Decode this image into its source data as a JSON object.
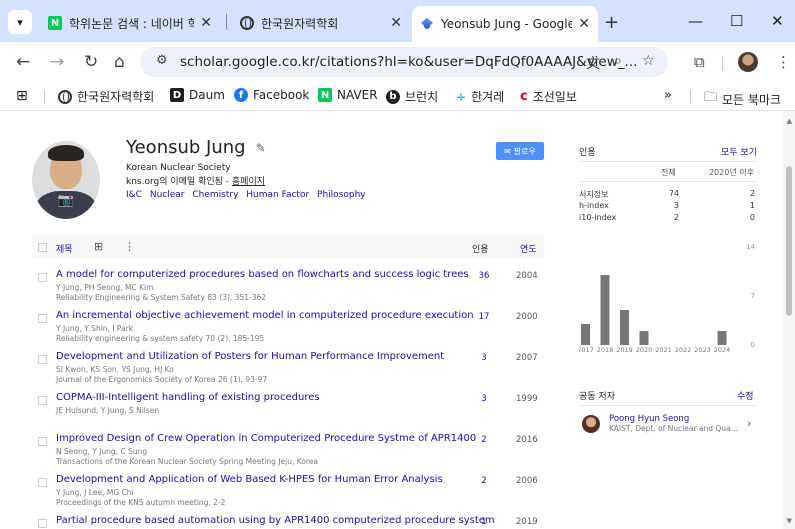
{
  "tabs": [
    {
      "title": "학위논문 검색 : 네이버 학",
      "active": false
    },
    {
      "title": "한국원자력학회",
      "active": false
    },
    {
      "title": "Yeonsub Jung - Google",
      "active": true
    }
  ],
  "toolbar": {
    "url": "scholar.google.co.kr/citations?hl=ko&user=DqFdQf0AAAAJ&view_..."
  },
  "bookmarks": [
    {
      "label": "한국원자력학회",
      "icon": "globe-icon"
    },
    {
      "label": "Daum",
      "icon": "daum-icon",
      "glyph": "D",
      "color": "#1f1f1f"
    },
    {
      "label": "Facebook",
      "icon": "facebook-icon",
      "glyph": "f",
      "color": "#1877f2"
    },
    {
      "label": "NAVER",
      "icon": "naver-icon",
      "glyph": "N",
      "color": "#03c75a"
    },
    {
      "label": "브런치",
      "icon": "brunch-icon",
      "glyph": "b",
      "color": "#222"
    },
    {
      "label": "한겨레",
      "icon": "hani-icon",
      "glyph": "한",
      "color": "#3ba3d6"
    },
    {
      "label": "조선일보",
      "icon": "chosun-icon",
      "glyph": "C",
      "color": "#d0021b"
    }
  ],
  "bookmarks_all": "모든 북마크",
  "profile": {
    "name": "Yeonsub Jung",
    "affiliation": "Korean Nuclear Society",
    "email_text": "kns.org의 이메일 확인됨 - ",
    "homepage": "홈페이지",
    "tags": [
      "I&C",
      "Nuclear",
      "Chemistry",
      "Human Factor",
      "Philosophy"
    ],
    "follow": "팔로우"
  },
  "articles_header": {
    "title": "제목",
    "cited": "인용",
    "year": "연도"
  },
  "articles": [
    {
      "title": "A model for computerized procedures based on flowcharts and success logic trees",
      "authors": "Y Jung, PH Seong, MC Kim",
      "journal": "Reliability Engineering & System Safety 83 (3), 351-362",
      "cited": "36",
      "year": "2004"
    },
    {
      "title": "An incremental objective achievement model in computerized procedure execution",
      "authors": "Y Jung, Y Shin, I Park",
      "journal": "Reliability engineering & system safety 70 (2), 185-195",
      "cited": "17",
      "year": "2000"
    },
    {
      "title": "Development and Utilization of Posters for Human Performance Improvement",
      "authors": "SI Kwon, KS Son, YS Jung, HJ Ko",
      "journal": "Journal of the Ergonomics Society of Korea 26 (1), 93-97",
      "cited": "3",
      "year": "2007"
    },
    {
      "title": "COPMA-III-Intelligent handling of existing procedures",
      "authors": "JE Hulsund, Y Jung, S Nilsen",
      "journal": "",
      "cited": "3",
      "year": "1999"
    },
    {
      "title": "Improved Design of Crew Operation in Computerized Procedure Systme of APR1400",
      "authors": "N Seong, Y Jung, C Sung",
      "journal": "Transactions of the Korean Nuclear Society Spring Meeting Jeju, Korea",
      "cited": "2",
      "year": "2016"
    },
    {
      "title": "Development and Application of Web Based K-HPES for Human Error Analysis",
      "authors": "Y Jung, J Lee, MG Chi",
      "journal": "Proceedings of the KNS autumn meeting, 2-2",
      "cited": "2",
      "year": "2006"
    },
    {
      "title": "Partial procedure based automation using by APR1400 computerized procedure system",
      "authors": "N Seong, Y Jung, C Sung, PH Seong",
      "journal": "",
      "cited": "1",
      "year": "2019"
    }
  ],
  "citations": {
    "label": "인용",
    "view_all": "모두 보기",
    "col_all": "전체",
    "col_since": "2020년 이후",
    "rows": [
      {
        "name": "서지정보",
        "all": "74",
        "since": "2"
      },
      {
        "name": "h-index",
        "all": "3",
        "since": "1"
      },
      {
        "name": "i10-index",
        "all": "2",
        "since": "0"
      }
    ]
  },
  "chart_data": {
    "type": "bar",
    "categories": [
      "2017",
      "2018",
      "2019",
      "2020",
      "2021",
      "2022",
      "2023",
      "2024"
    ],
    "values": [
      3,
      10,
      5,
      2,
      0,
      0,
      0,
      2
    ],
    "ylim": [
      0,
      14
    ],
    "yticks": [
      "0",
      "7",
      "14"
    ],
    "color": "#777777"
  },
  "coauthors": {
    "label": "공동 저자",
    "edit": "수정",
    "items": [
      {
        "name": "Poong Hyun Seong",
        "affiliation": "KAIST, Dept. of Nuclear and Qua..."
      }
    ]
  }
}
